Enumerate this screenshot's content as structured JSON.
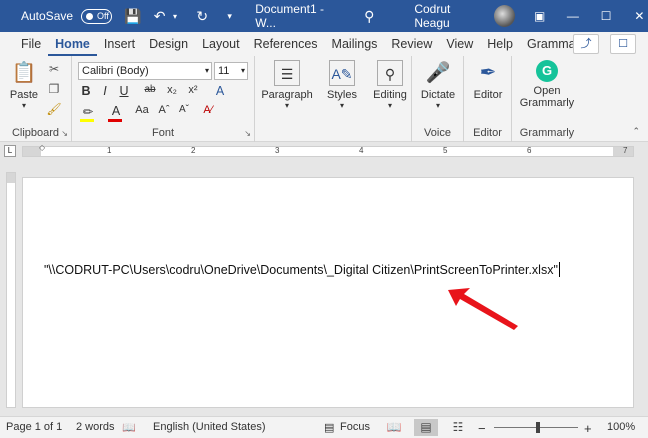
{
  "titlebar": {
    "autosave_label": "AutoSave",
    "autosave_state": "Off",
    "doc_title": "Document1 - W...",
    "user_name": "Codrut Neagu"
  },
  "tabs": [
    {
      "label": "File"
    },
    {
      "label": "Home"
    },
    {
      "label": "Insert"
    },
    {
      "label": "Design"
    },
    {
      "label": "Layout"
    },
    {
      "label": "References"
    },
    {
      "label": "Mailings"
    },
    {
      "label": "Review"
    },
    {
      "label": "View"
    },
    {
      "label": "Help"
    },
    {
      "label": "Grammarly"
    }
  ],
  "ribbon": {
    "clipboard": {
      "paste_label": "Paste",
      "group_label": "Clipboard"
    },
    "font": {
      "font_name": "Calibri (Body)",
      "font_size": "11",
      "group_label": "Font",
      "bold": "B",
      "italic": "I",
      "underline": "U",
      "strike": "ab",
      "sub": "x₂",
      "sup": "x²",
      "case": "Aa"
    },
    "paragraph": {
      "label": "Paragraph"
    },
    "styles": {
      "label": "Styles"
    },
    "editing": {
      "label": "Editing"
    },
    "voice": {
      "button": "Dictate",
      "group_label": "Voice"
    },
    "editor": {
      "button": "Editor",
      "group_label": "Editor"
    },
    "grammarly": {
      "button_line1": "Open",
      "button_line2": "Grammarly",
      "group_label": "Grammarly"
    }
  },
  "ruler": {
    "numbers": [
      "1",
      "2",
      "3",
      "4",
      "5",
      "6",
      "7"
    ]
  },
  "document": {
    "text": "\"\\\\CODRUT-PC\\Users\\codru\\OneDrive\\Documents\\_Digital Citizen\\PrintScreenToPrinter.xlsx\""
  },
  "status": {
    "page": "Page 1 of 1",
    "words": "2 words",
    "language": "English (United States)",
    "focus": "Focus",
    "zoom": "100%",
    "zoom_value": 1.0
  },
  "colors": {
    "titlebar": "#2b579a",
    "accent": "#2b579a",
    "arrow": "#e8141b"
  }
}
